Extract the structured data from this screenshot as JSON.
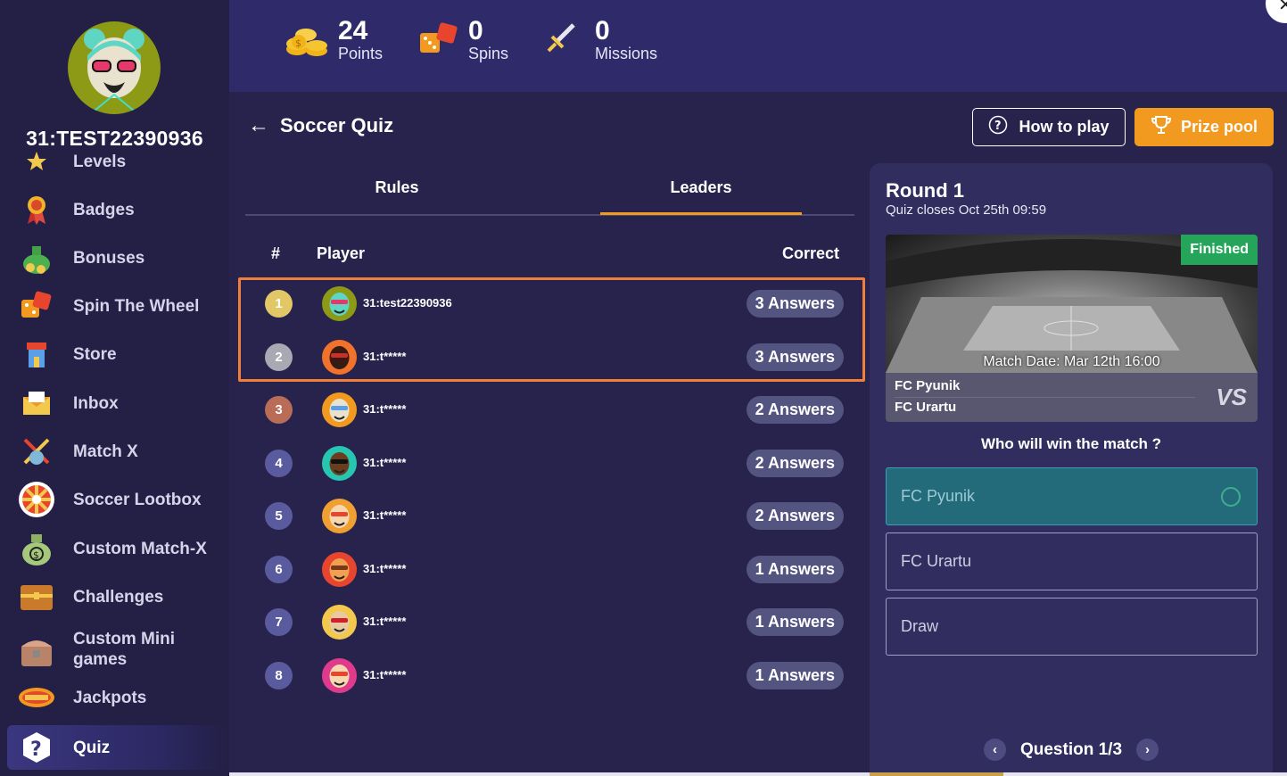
{
  "profile": {
    "username": "31:TEST22390936"
  },
  "sidebar": {
    "items": [
      {
        "label": "Levels",
        "icon": "levels-icon"
      },
      {
        "label": "Badges",
        "icon": "badge-icon"
      },
      {
        "label": "Bonuses",
        "icon": "money-bag-icon"
      },
      {
        "label": "Spin The Wheel",
        "icon": "dice-icon"
      },
      {
        "label": "Store",
        "icon": "store-icon"
      },
      {
        "label": "Inbox",
        "icon": "envelope-icon"
      },
      {
        "label": "Match X",
        "icon": "crossed-sticks-icon"
      },
      {
        "label": "Soccer Lootbox",
        "icon": "wheel-icon"
      },
      {
        "label": "Custom Match-X",
        "icon": "money-sack-icon"
      },
      {
        "label": "Challenges",
        "icon": "chest-icon"
      },
      {
        "label": "Custom Mini games",
        "icon": "treasure-chest-icon"
      },
      {
        "label": "Jackpots",
        "icon": "jackpot-icon"
      },
      {
        "label": "Quiz",
        "icon": "question-icon"
      }
    ]
  },
  "topbar": {
    "stats": [
      {
        "value": "24",
        "label": "Points",
        "icon": "coins-icon"
      },
      {
        "value": "0",
        "label": "Spins",
        "icon": "dice-icon"
      },
      {
        "value": "0",
        "label": "Missions",
        "icon": "sword-icon"
      }
    ]
  },
  "page": {
    "title": "Soccer Quiz",
    "how_to_play": "How to play",
    "prize_pool": "Prize pool",
    "tabs": [
      "Rules",
      "Leaders"
    ],
    "active_tab": "Leaders"
  },
  "leaderboard": {
    "headers": {
      "rank": "#",
      "player": "Player",
      "correct": "Correct"
    },
    "rows": [
      {
        "rank": "1",
        "name": "31:test22390936",
        "answers": "3 Answers",
        "medal": "#e2c766"
      },
      {
        "rank": "2",
        "name": "31:t*****",
        "answers": "3 Answers",
        "medal": "#a9a9b3"
      },
      {
        "rank": "3",
        "name": "31:t*****",
        "answers": "2 Answers",
        "medal": "#b96c56"
      },
      {
        "rank": "4",
        "name": "31:t*****",
        "answers": "2 Answers",
        "medal": "#5a5b9e"
      },
      {
        "rank": "5",
        "name": "31:t*****",
        "answers": "2 Answers",
        "medal": "#5a5b9e"
      },
      {
        "rank": "6",
        "name": "31:t*****",
        "answers": "1 Answers",
        "medal": "#5a5b9e"
      },
      {
        "rank": "7",
        "name": "31:t*****",
        "answers": "1 Answers",
        "medal": "#5a5b9e"
      },
      {
        "rank": "8",
        "name": "31:t*****",
        "answers": "1 Answers",
        "medal": "#5a5b9e"
      }
    ]
  },
  "round": {
    "title": "Round 1",
    "closes": "Quiz closes Oct 25th 09:59",
    "status": "Finished",
    "match_date": "Match Date: Mar 12th 16:00",
    "team1": "FC Pyunik",
    "team2": "FC Urartu",
    "vs": "VS",
    "question": "Who will win the match ?",
    "options": [
      "FC Pyunik",
      "FC Urartu",
      "Draw"
    ],
    "selected": "FC Pyunik",
    "pager": "Question 1/3"
  }
}
